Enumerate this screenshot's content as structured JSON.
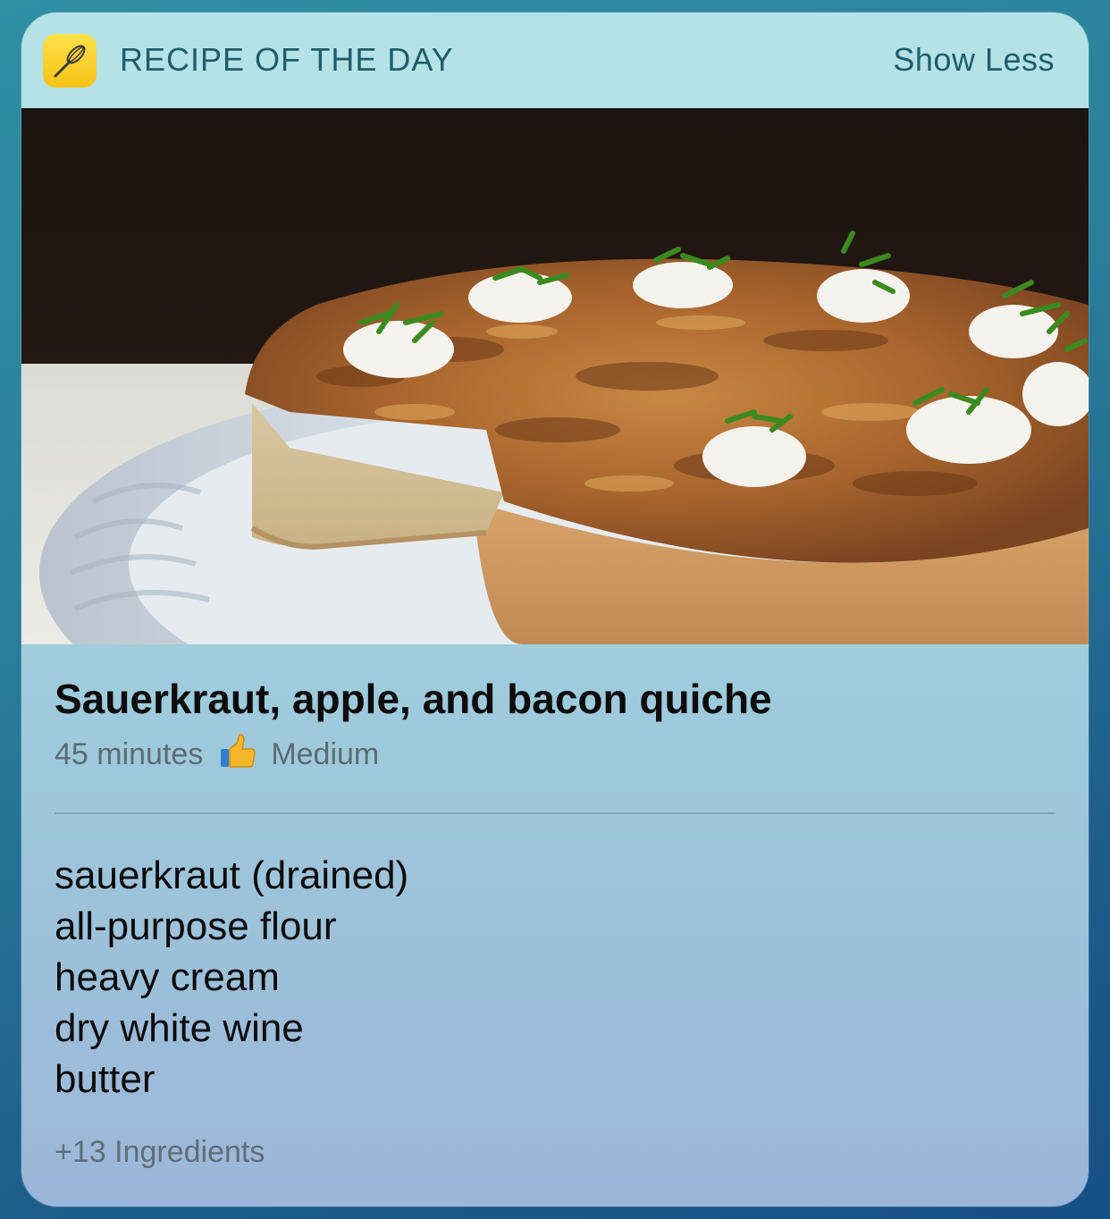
{
  "header": {
    "app_icon": "whisk-icon",
    "title": "RECIPE OF THE DAY",
    "show_less_label": "Show Less"
  },
  "photo": {
    "subject": "quiche-photo"
  },
  "recipe": {
    "title": "Sauerkraut, apple, and bacon quiche",
    "time": "45 minutes",
    "difficulty_icon": "thumbs-up-icon",
    "difficulty": "Medium"
  },
  "ingredients": [
    "sauerkraut (drained)",
    "all-purpose flour",
    "heavy cream",
    "dry white wine",
    "butter"
  ],
  "more_ingredients": "+13 Ingredients",
  "colors": {
    "header_bg": "#b5e2e6",
    "header_text": "#1f5d6c",
    "icon_yellow": "#f5c315"
  }
}
